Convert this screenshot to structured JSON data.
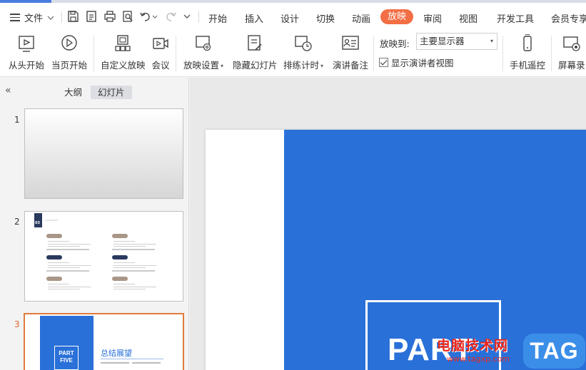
{
  "menubar": {
    "file_label": "文件",
    "tabs": [
      {
        "label": "开始",
        "active": false
      },
      {
        "label": "插入",
        "active": false
      },
      {
        "label": "设计",
        "active": false
      },
      {
        "label": "切换",
        "active": false
      },
      {
        "label": "动画",
        "active": false
      },
      {
        "label": "放映",
        "active": true
      },
      {
        "label": "审阅",
        "active": false
      },
      {
        "label": "视图",
        "active": false
      },
      {
        "label": "开发工具",
        "active": false
      },
      {
        "label": "会员专享",
        "active": false
      }
    ]
  },
  "ribbon": {
    "from_start": "从头开始",
    "from_current": "当页开始",
    "custom_show": "自定义放映",
    "meeting": "会议",
    "show_settings": "放映设置",
    "hide_slide": "隐藏幻灯片",
    "rehearse_timing": "排练计时",
    "speaker_notes": "演讲备注",
    "show_to_label": "放映到:",
    "show_to_value": "主要显示器",
    "presenter_view_label": "显示演讲者视图",
    "presenter_view_checked": true,
    "phone_remote": "手机遥控",
    "screen_record": "屏幕录"
  },
  "panel": {
    "tabs": [
      {
        "label": "大纲",
        "active": false
      },
      {
        "label": "幻灯片",
        "active": true
      }
    ],
    "slides": [
      {
        "number": "1"
      },
      {
        "number": "2",
        "badge": "03"
      },
      {
        "number": "3",
        "part_label": "PART\nFIVE",
        "title": "总结展望"
      }
    ]
  },
  "canvas": {
    "slide_text": "PART"
  },
  "watermark": {
    "site_name": "电脑技术网",
    "url": "www.tagxp.com",
    "tag": "TAG"
  },
  "colors": {
    "accent": "#f36e44",
    "slide_blue": "#2970d8",
    "tab_highlight": "#4a7ddf",
    "selected_thumb_border": "#e07a3c"
  }
}
